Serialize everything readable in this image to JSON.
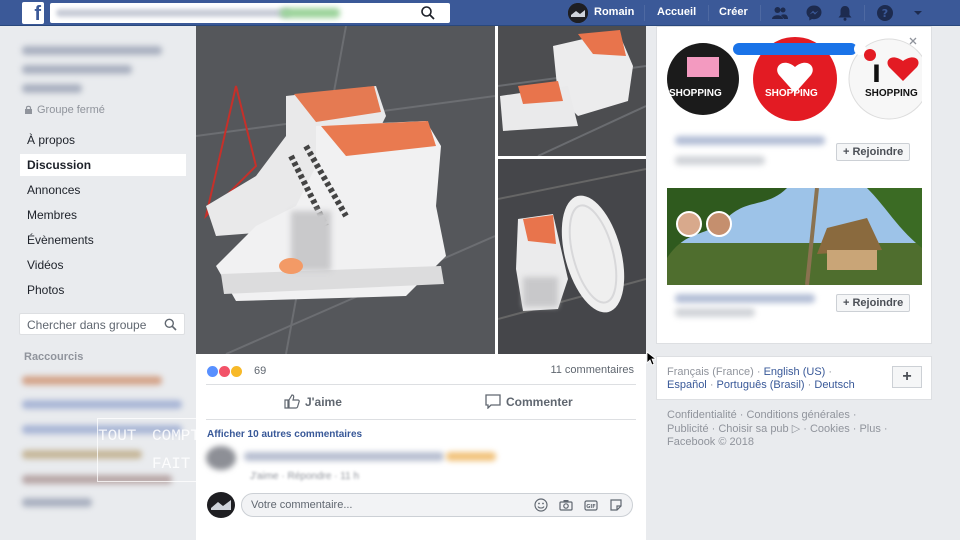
{
  "topbar": {
    "logo_letter": "f",
    "user_name": "Romain",
    "home_label": "Accueil",
    "create_label": "Créer",
    "icons": [
      "friends-icon",
      "messenger-icon",
      "notifications-icon",
      "help-icon",
      "menu-caret-icon"
    ]
  },
  "sidebar": {
    "group_status": "Groupe fermé",
    "items": [
      {
        "label": "À propos"
      },
      {
        "label": "Discussion",
        "active": true
      },
      {
        "label": "Annonces"
      },
      {
        "label": "Membres"
      },
      {
        "label": "Évènements"
      },
      {
        "label": "Vidéos"
      },
      {
        "label": "Photos"
      }
    ],
    "search_placeholder": "Chercher dans groupe",
    "shortcuts_label": "Raccourcis"
  },
  "watermark": {
    "line1a": "TOUT",
    "line1b": "COMPTE",
    "line2": "FAIT"
  },
  "post": {
    "reaction_count": "69",
    "comments_count": "11 commentaires",
    "like_label": "J'aime",
    "comment_label": "Commenter",
    "more_comments": "Afficher 10 autres commentaires",
    "comment_meta": "J'aime · Répondre · 11 h",
    "comment_placeholder": "Votre commentaire..."
  },
  "right": {
    "shopping_labels": [
      "SHOPPING",
      "SHOPPING",
      "SHOPPING"
    ],
    "join_label": "+ Rejoindre",
    "languages": {
      "current": "Français (France)",
      "others": [
        "English (US)",
        "Español",
        "Português (Brasil)",
        "Deutsch"
      ],
      "add_label": "+"
    },
    "footer": {
      "line1": "Confidentialité · Conditions générales ·",
      "line2": "Publicité · Choisir sa pub ▷ · Cookies · Plus ·",
      "line3": "Facebook © 2018"
    }
  },
  "colors": {
    "brand": "#3b5998",
    "link": "#385898",
    "sneaker_accent": "#e8764e"
  }
}
